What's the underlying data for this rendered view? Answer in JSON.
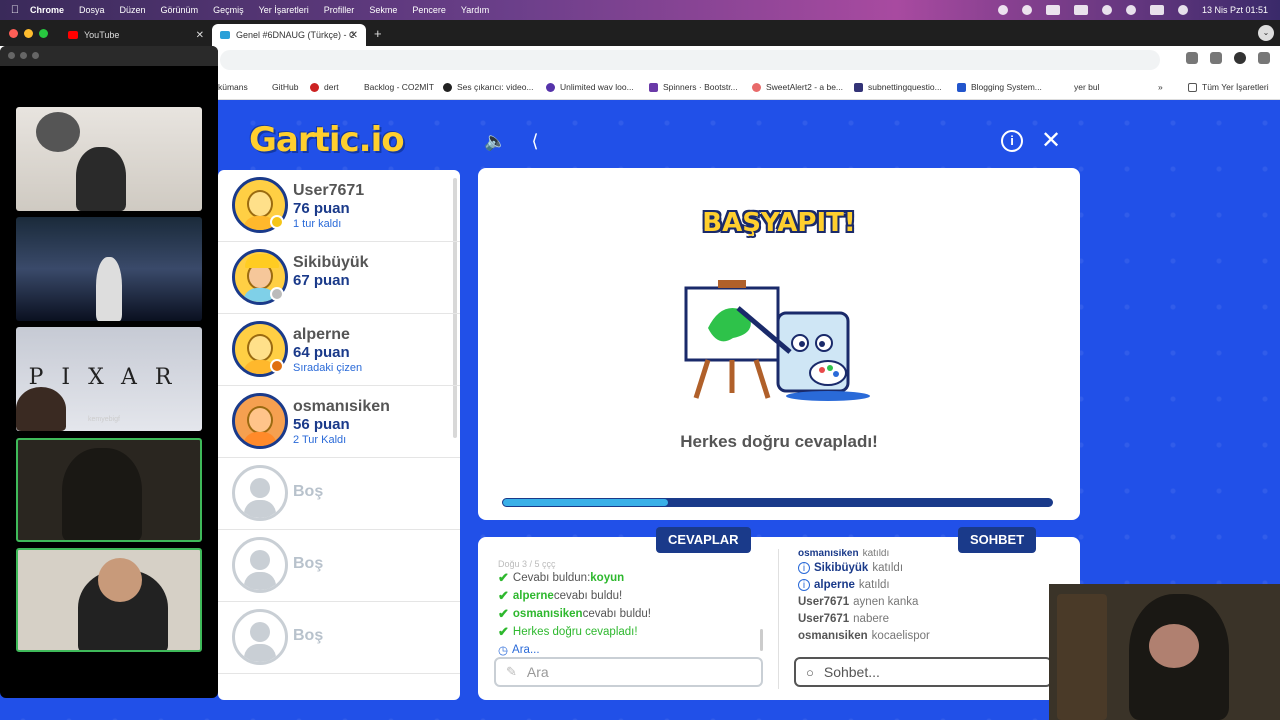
{
  "menubar": {
    "items": [
      "Chrome",
      "Dosya",
      "Düzen",
      "Görünüm",
      "Geçmiş",
      "Yer İşaretleri",
      "Profiller",
      "Sekme",
      "Pencere",
      "Yardım"
    ],
    "datetime": "13 Nis Pzt  01:51"
  },
  "tabs": [
    {
      "label": "YouTube",
      "favicon_color": "#ff0000"
    },
    {
      "label": "Genel #6DNAUG (Türkçe) - G",
      "favicon_color": "#2aa0d8"
    }
  ],
  "bookmarks": [
    {
      "label": "kümans",
      "color": "#999999"
    },
    {
      "label": "GitHub",
      "color": "#ffffff"
    },
    {
      "label": "dert",
      "color": "#cc2222"
    },
    {
      "label": "Backlog - CO2MİT",
      "color": "#ffffff"
    },
    {
      "label": "Ses çıkarıcı: video...",
      "color": "#222222"
    },
    {
      "label": "Unlimited wav loo...",
      "color": "#5533aa"
    },
    {
      "label": "Spinners · Bootstr...",
      "color": "#6a3aa8"
    },
    {
      "label": "SweetAlert2 - a be...",
      "color": "#e86a6a"
    },
    {
      "label": "subnettingquestio...",
      "color": "#333377"
    },
    {
      "label": "Blogging System...",
      "color": "#2255cc"
    },
    {
      "label": "yer bul",
      "color": "#2255cc"
    }
  ],
  "bookmarks_all": "Tüm Yer İşaretleri",
  "game": {
    "logo": "Gartic.io",
    "players": [
      {
        "name": "User7671",
        "score": "76 puan",
        "note": "1 tur kaldı",
        "dot": "#f5c518",
        "style": "yellow"
      },
      {
        "name": "Sikibüyük",
        "score": "67 puan",
        "note": "",
        "dot": "#bbbbbb",
        "style": "cap"
      },
      {
        "name": "alperne",
        "score": "64 puan",
        "note": "Sıradaki çizen",
        "dot": "#e07010",
        "style": "yellow"
      },
      {
        "name": "osmanısiken",
        "score": "56 puan",
        "note": "2 Tur Kaldı",
        "dot": "",
        "style": "orange"
      },
      {
        "name": "Boş"
      },
      {
        "name": "Boş"
      },
      {
        "name": "Boş"
      }
    ],
    "banner": "BAŞYAPIT!",
    "stage_message": "Herkes doğru cevapladı!",
    "progress": 0.3,
    "answers_label": "CEVAPLAR",
    "chat_label": "SOHBET",
    "answers": [
      {
        "type": "ghost",
        "text": "Doğu 3 / 5 ççç"
      },
      {
        "type": "check",
        "pre": "Cevabı buldun: ",
        "hl": "koyun",
        "post": ""
      },
      {
        "type": "check",
        "pre": "",
        "hl": "alperne",
        "post": " cevabı buldu!"
      },
      {
        "type": "check",
        "pre": "",
        "hl": "osmanısiken",
        "post": " cevabı buldu!"
      },
      {
        "type": "check",
        "pre": "",
        "hl": "",
        "post": "Herkes doğru cevapladı!",
        "green": true
      },
      {
        "type": "clock",
        "text": "Ara..."
      }
    ],
    "chat": [
      {
        "type": "ghost",
        "name": "osmanısiken",
        "text": "katıldı"
      },
      {
        "type": "info",
        "name": "Sikibüyük",
        "text": "katıldı"
      },
      {
        "type": "info",
        "name": "alperne",
        "text": "katıldı"
      },
      {
        "type": "msg",
        "name": "User7671",
        "text": "aynen kanka"
      },
      {
        "type": "msg",
        "name": "User7671",
        "text": "nabere"
      },
      {
        "type": "msg",
        "name": "osmanısiken",
        "text": "kocaelispor"
      }
    ],
    "answer_placeholder": "Ara",
    "chat_placeholder": "Sohbet..."
  },
  "call": {
    "tile_text": "PIXAR",
    "tile_caption": "kemyebigf"
  }
}
